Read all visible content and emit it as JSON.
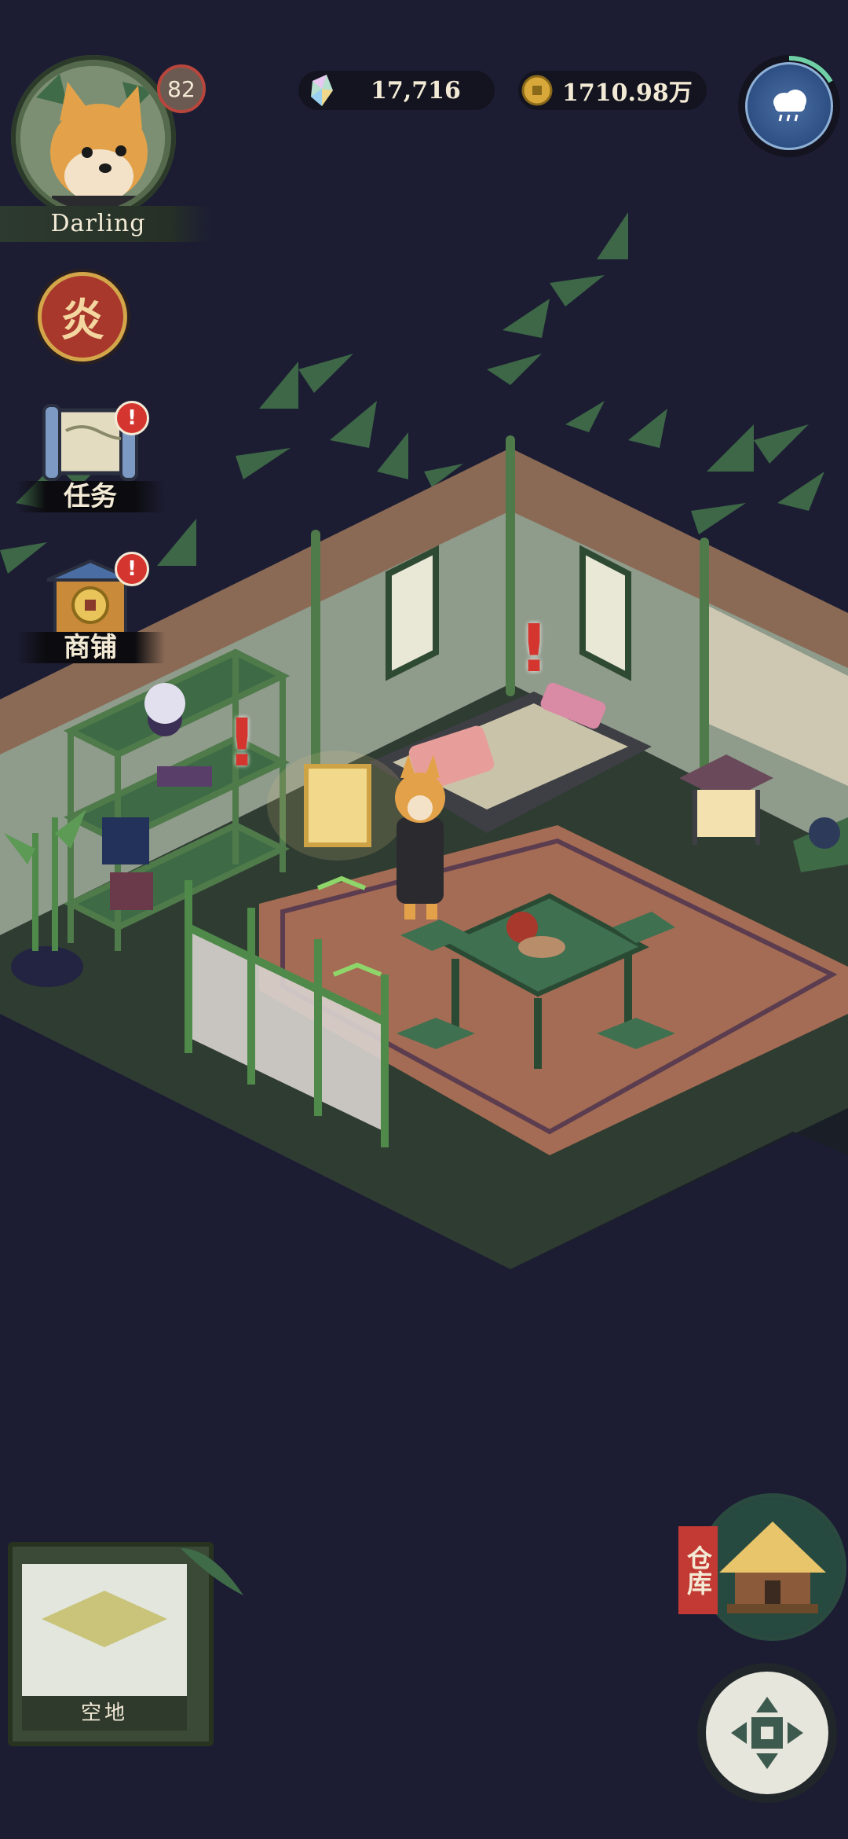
{
  "player": {
    "name": "Darling",
    "level": "82"
  },
  "currencies": {
    "gems": "17,716",
    "coins": "1710.98万"
  },
  "side_menu": {
    "tasks_label": "任务",
    "shop_label": "商铺",
    "fire_glyph": "炎",
    "tasks_alert": "!",
    "shop_alert": "!"
  },
  "scene": {
    "alert_mark": "!"
  },
  "bottom": {
    "slot_label": "空地",
    "warehouse_label": "仓库"
  },
  "colors": {
    "background": "#1c1d33",
    "alert": "#d4362f",
    "accent_gold": "#d4a64a"
  },
  "icons": {
    "weather": "rain-cloud-icon",
    "gem": "gem-icon",
    "coin": "coin-icon",
    "move": "move-arrows-icon"
  }
}
